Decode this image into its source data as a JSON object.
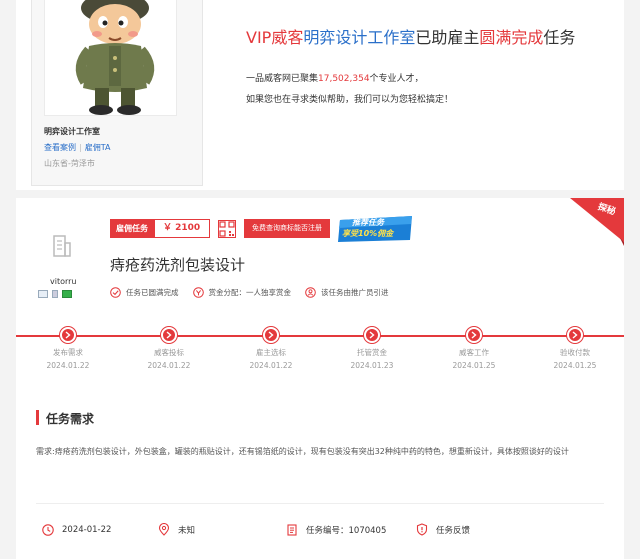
{
  "studio": {
    "name": "明弈设计工作室",
    "link_cases": "查看案例",
    "link_hire": "雇佣TA",
    "link_separator": "|",
    "region": "山东省-菏泽市"
  },
  "headline": {
    "part1": "VIP威客",
    "part2": "明弈设计工作室",
    "part3": "已助雇主",
    "part4": "圆满完成",
    "part5": "任务"
  },
  "stats": {
    "prefix": "一品威客网已聚集",
    "count": "17,502,354",
    "suffix": "个专业人才，",
    "help": "如果您也在寻求类似帮助，我们可以为您轻松搞定！"
  },
  "ribbon": {
    "text": "探秘"
  },
  "employer": {
    "name": "vitorru"
  },
  "task": {
    "type": "雇佣任务",
    "price": "￥ 2100",
    "trademark_button": "免费查询商标能否注册",
    "promo_line1": "推荐任务",
    "promo_line2": "享受10%佣金",
    "title": "痔疮药洗剂包装设计",
    "status_completed": "任务已圆满完成",
    "bounty_assign": "赏金分配：一人独享赏金",
    "referral": "该任务由推广员引进"
  },
  "steps": [
    {
      "label": "发布需求",
      "date": "2024.01.22"
    },
    {
      "label": "威客投标",
      "date": "2024.01.22"
    },
    {
      "label": "雇主选标",
      "date": "2024.01.22"
    },
    {
      "label": "托管赏金",
      "date": "2024.01.23"
    },
    {
      "label": "威客工作",
      "date": "2024.01.25"
    },
    {
      "label": "验收付款",
      "date": "2024.01.25"
    }
  ],
  "requirements": {
    "title": "任务需求",
    "text": "需求:痔疮药洗剂包装设计，外包装盒，罐装的瓶贴设计，还有锡箔纸的设计，现有包装没有突出32种纯中药的特色，想重新设计，具体按照谈好的设计"
  },
  "meta": {
    "date": "2024-01-22",
    "location": "未知",
    "task_no": "任务编号：1070405",
    "feedback": "任务反馈"
  },
  "colors": {
    "accent": "#e4393c",
    "link": "#2a6fc9"
  }
}
